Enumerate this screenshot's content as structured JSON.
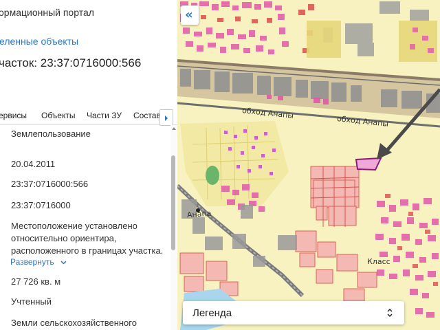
{
  "header": {
    "portal_title": "ормационный портал",
    "selected_objects_link": "еленные объекты",
    "parcel_title": "часток: 23:37:0716000:566"
  },
  "tabs": [
    "ервисы",
    "Объекты",
    "Части ЗУ",
    "Состав"
  ],
  "fields": {
    "land_use": "Землепользование",
    "date": "20.04.2011",
    "cadastral_number": "23:37:0716000:566",
    "quarter_number": "23:37:0716000",
    "location_line1": "Местоположение установлено",
    "location_line2": "относительно ориентира,",
    "location_line3": "расположенного в границах участка.",
    "expand_label": "Развернуть",
    "area": "27 726 кв. м",
    "status": "Учтенный",
    "category": "Земли сельскохозяйственного"
  },
  "map": {
    "collapse_icon_glyph": "«",
    "legend_label": "Легенда",
    "road_label_1": "обход Анапы",
    "road_label_2": "обход Анапы",
    "city_label": "Анапа",
    "district_label": "Класс"
  },
  "colors": {
    "link": "#2a78c4",
    "map_background": "#f7f2c0",
    "parcel_pink": "#e05aa8",
    "parcel_red": "#d94545",
    "highlighted_parcel": "#a0208a"
  },
  "icons": {
    "collapse": "double-chevron-left-icon",
    "tab_next": "triangle-right-icon",
    "expand": "chevron-down-icon",
    "legend_toggle": "chevron-updown-icon",
    "pointer": "arrow-pointer",
    "station": "railway-station-icon"
  }
}
